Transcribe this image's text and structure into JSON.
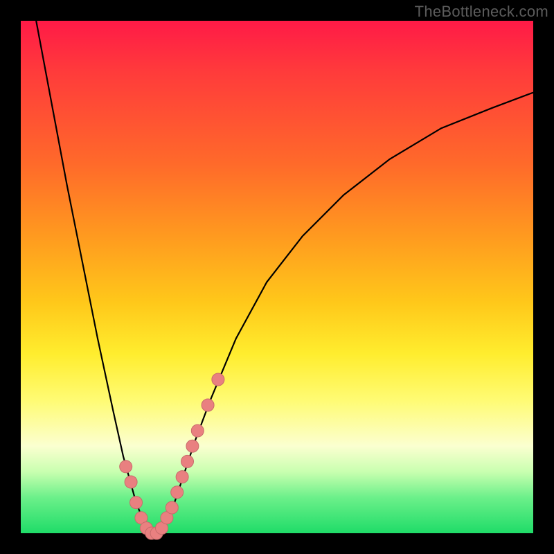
{
  "watermark": "TheBottleneck.com",
  "colors": {
    "frame": "#000000",
    "curve_stroke": "#000000",
    "marker_fill": "#e98080",
    "marker_stroke": "#c86b6b"
  },
  "chart_data": {
    "type": "line",
    "title": "",
    "xlabel": "",
    "ylabel": "",
    "xlim": [
      0,
      100
    ],
    "ylim": [
      0,
      100
    ],
    "annotations": [],
    "series": [
      {
        "name": "bottleneck-curve",
        "x": [
          3,
          6,
          9,
          12,
          15,
          18,
          20,
          22.5,
          24.5,
          26,
          27.5,
          30,
          32,
          34,
          37,
          42,
          48,
          55,
          63,
          72,
          82,
          92,
          100
        ],
        "y": [
          100,
          84,
          68,
          53,
          38,
          24,
          15,
          6,
          1,
          0,
          1,
          6,
          12,
          18,
          26,
          38,
          49,
          58,
          66,
          73,
          79,
          83,
          86
        ]
      }
    ],
    "markers": {
      "name": "highlighted-points",
      "x": [
        20.5,
        21.5,
        22.5,
        23.5,
        24.5,
        25.5,
        26.5,
        27.5,
        28.5,
        29.5,
        30.5,
        31.5,
        32.5,
        33.5,
        34.5,
        36.5,
        38.5
      ],
      "y": [
        13,
        10,
        6,
        3,
        1,
        0,
        0,
        1,
        3,
        5,
        8,
        11,
        14,
        17,
        20,
        25,
        30
      ]
    }
  }
}
